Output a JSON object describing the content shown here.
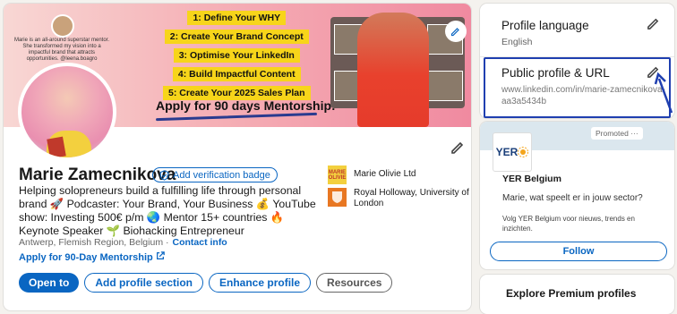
{
  "banner": {
    "mentor_text": "Marie is an all-around superstar mentor. She transformed my vision into a impactful brand that attracts opportunities. @leena.boagro",
    "steps": [
      "1: Define Your WHY",
      "2: Create Your Brand Concept",
      "3: Optimise Your LinkedIn",
      "4: Build Impactful Content",
      "5: Create Your 2025 Sales Plan"
    ],
    "apply_text": "Apply for 90 days Mentorship!"
  },
  "profile": {
    "name": "Marie Zamecnikova",
    "verify_label": "Add verification badge",
    "headline": "Helping solopreneurs build a fulfilling life through personal brand 🚀 Podcaster: Your Brand, Your Business 💰 YouTube show: Investing 500€ p/m 🌏 Mentor 15+ countries 🔥 Keynote Speaker 🌱 Biohacking Entrepreneur",
    "location": "Antwerp, Flemish Region, Belgium ·",
    "contact_info": "Contact info",
    "apply_link": "Apply for 90-Day Mentorship",
    "buttons": {
      "open_to": "Open to",
      "add_section": "Add profile section",
      "enhance": "Enhance profile",
      "resources": "Resources"
    },
    "orgs": [
      {
        "logo_text": "MARIE OLIVIE",
        "label": "Marie Olivie Ltd"
      },
      {
        "logo_text": "",
        "label": "Royal Holloway, University of London"
      }
    ]
  },
  "sidebar": {
    "language": {
      "title": "Profile language",
      "value": "English"
    },
    "public_url": {
      "title": "Public profile & URL",
      "url_line1": "www.linkedin.com/in/marie-zamecnikova-",
      "url_line2": "aa3a5434b"
    },
    "ad": {
      "logo_text": "YER",
      "promoted": "Promoted ···",
      "company": "YER Belgium",
      "question": "Marie, wat speelt er in jouw sector?",
      "body": "Volg YER Belgium voor nieuws, trends en inzichten.",
      "follow": "Follow"
    },
    "explore": {
      "title": "Explore Premium profiles"
    }
  },
  "colors": {
    "accent": "#0a66c2",
    "highlight": "#1f3fb0",
    "step_yellow": "#f7d51a"
  }
}
